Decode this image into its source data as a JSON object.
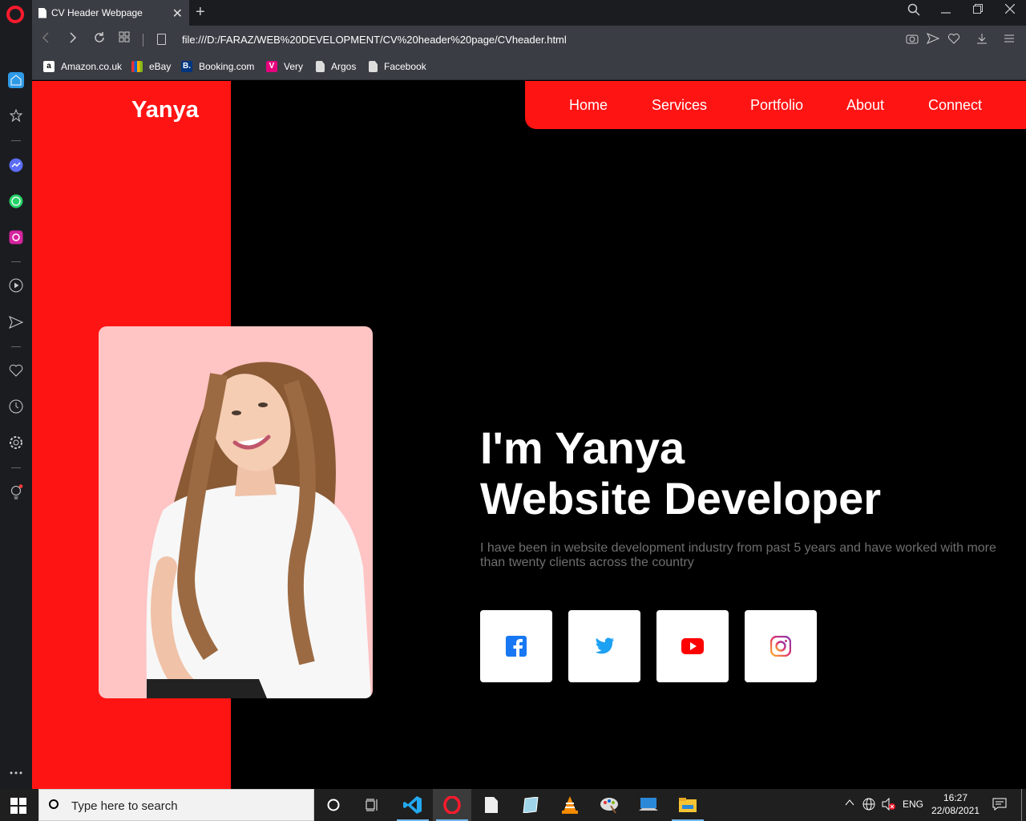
{
  "browser": {
    "tab_title": "CV Header Webpage",
    "tab_close": "✕",
    "new_tab": "+",
    "url": "file:///D:/FARAZ/WEB%20DEVELOPMENT/CV%20header%20page/CVheader.html",
    "bookmarks": [
      {
        "label": "Amazon.co.uk",
        "icon": "amazon-icon"
      },
      {
        "label": "eBay",
        "icon": "ebay-icon"
      },
      {
        "label": "Booking.com",
        "icon": "booking-icon"
      },
      {
        "label": "Very",
        "icon": "very-icon"
      },
      {
        "label": "Argos",
        "icon": "document-icon"
      },
      {
        "label": "Facebook",
        "icon": "document-icon"
      }
    ]
  },
  "page": {
    "logo": "Yanya",
    "nav": [
      "Home",
      "Services",
      "Portfolio",
      "About",
      "Connect"
    ],
    "hero": {
      "line1": "I'm Yanya",
      "line2": "Website Developer",
      "description": "I have been in website development industry from past 5 years and have worked with more than twenty clients across the country"
    },
    "social": [
      "facebook-icon",
      "twitter-icon",
      "youtube-icon",
      "instagram-icon"
    ],
    "colors": {
      "accent": "#ff1414",
      "photo_bg": "#ffc4c4",
      "background": "#000000"
    }
  },
  "taskbar": {
    "search_placeholder": "Type here to search",
    "language": "ENG",
    "time": "16:27",
    "date": "22/08/2021"
  }
}
